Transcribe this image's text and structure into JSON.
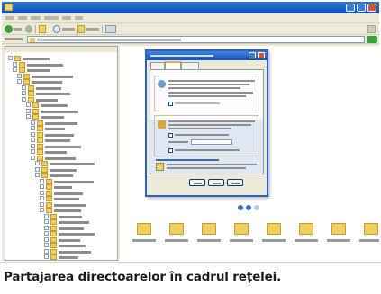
{
  "window": {
    "title": "",
    "address": ""
  },
  "menu": {
    "items": [
      "",
      "",
      "",
      "",
      "",
      ""
    ]
  },
  "toolbar": {
    "back_label": "",
    "search_label": "",
    "folders_label": ""
  },
  "tree": {
    "nodes": [
      "",
      "",
      "",
      "",
      "",
      "",
      "",
      "",
      "",
      "",
      "",
      "",
      "",
      "",
      "",
      "",
      "",
      "",
      "",
      "",
      "",
      "",
      "",
      "",
      "",
      "",
      "",
      "",
      "",
      "",
      "",
      "",
      "",
      "",
      ""
    ]
  },
  "files": {
    "names": [
      "",
      "",
      "",
      "",
      "",
      "",
      "",
      ""
    ]
  },
  "dialog": {
    "title": "",
    "tabs": [
      "",
      "",
      ""
    ],
    "buttons": [
      "",
      "",
      ""
    ]
  },
  "caption": {
    "text": "Partajarea directoarelor în cadrul rețelei."
  },
  "colors": {
    "titlebar": "#1553bd",
    "folder": "#f1cf5e",
    "dialog_border": "#2a62c8",
    "address_go": "#3aa23c",
    "caption_text": "#1b1b1b"
  }
}
